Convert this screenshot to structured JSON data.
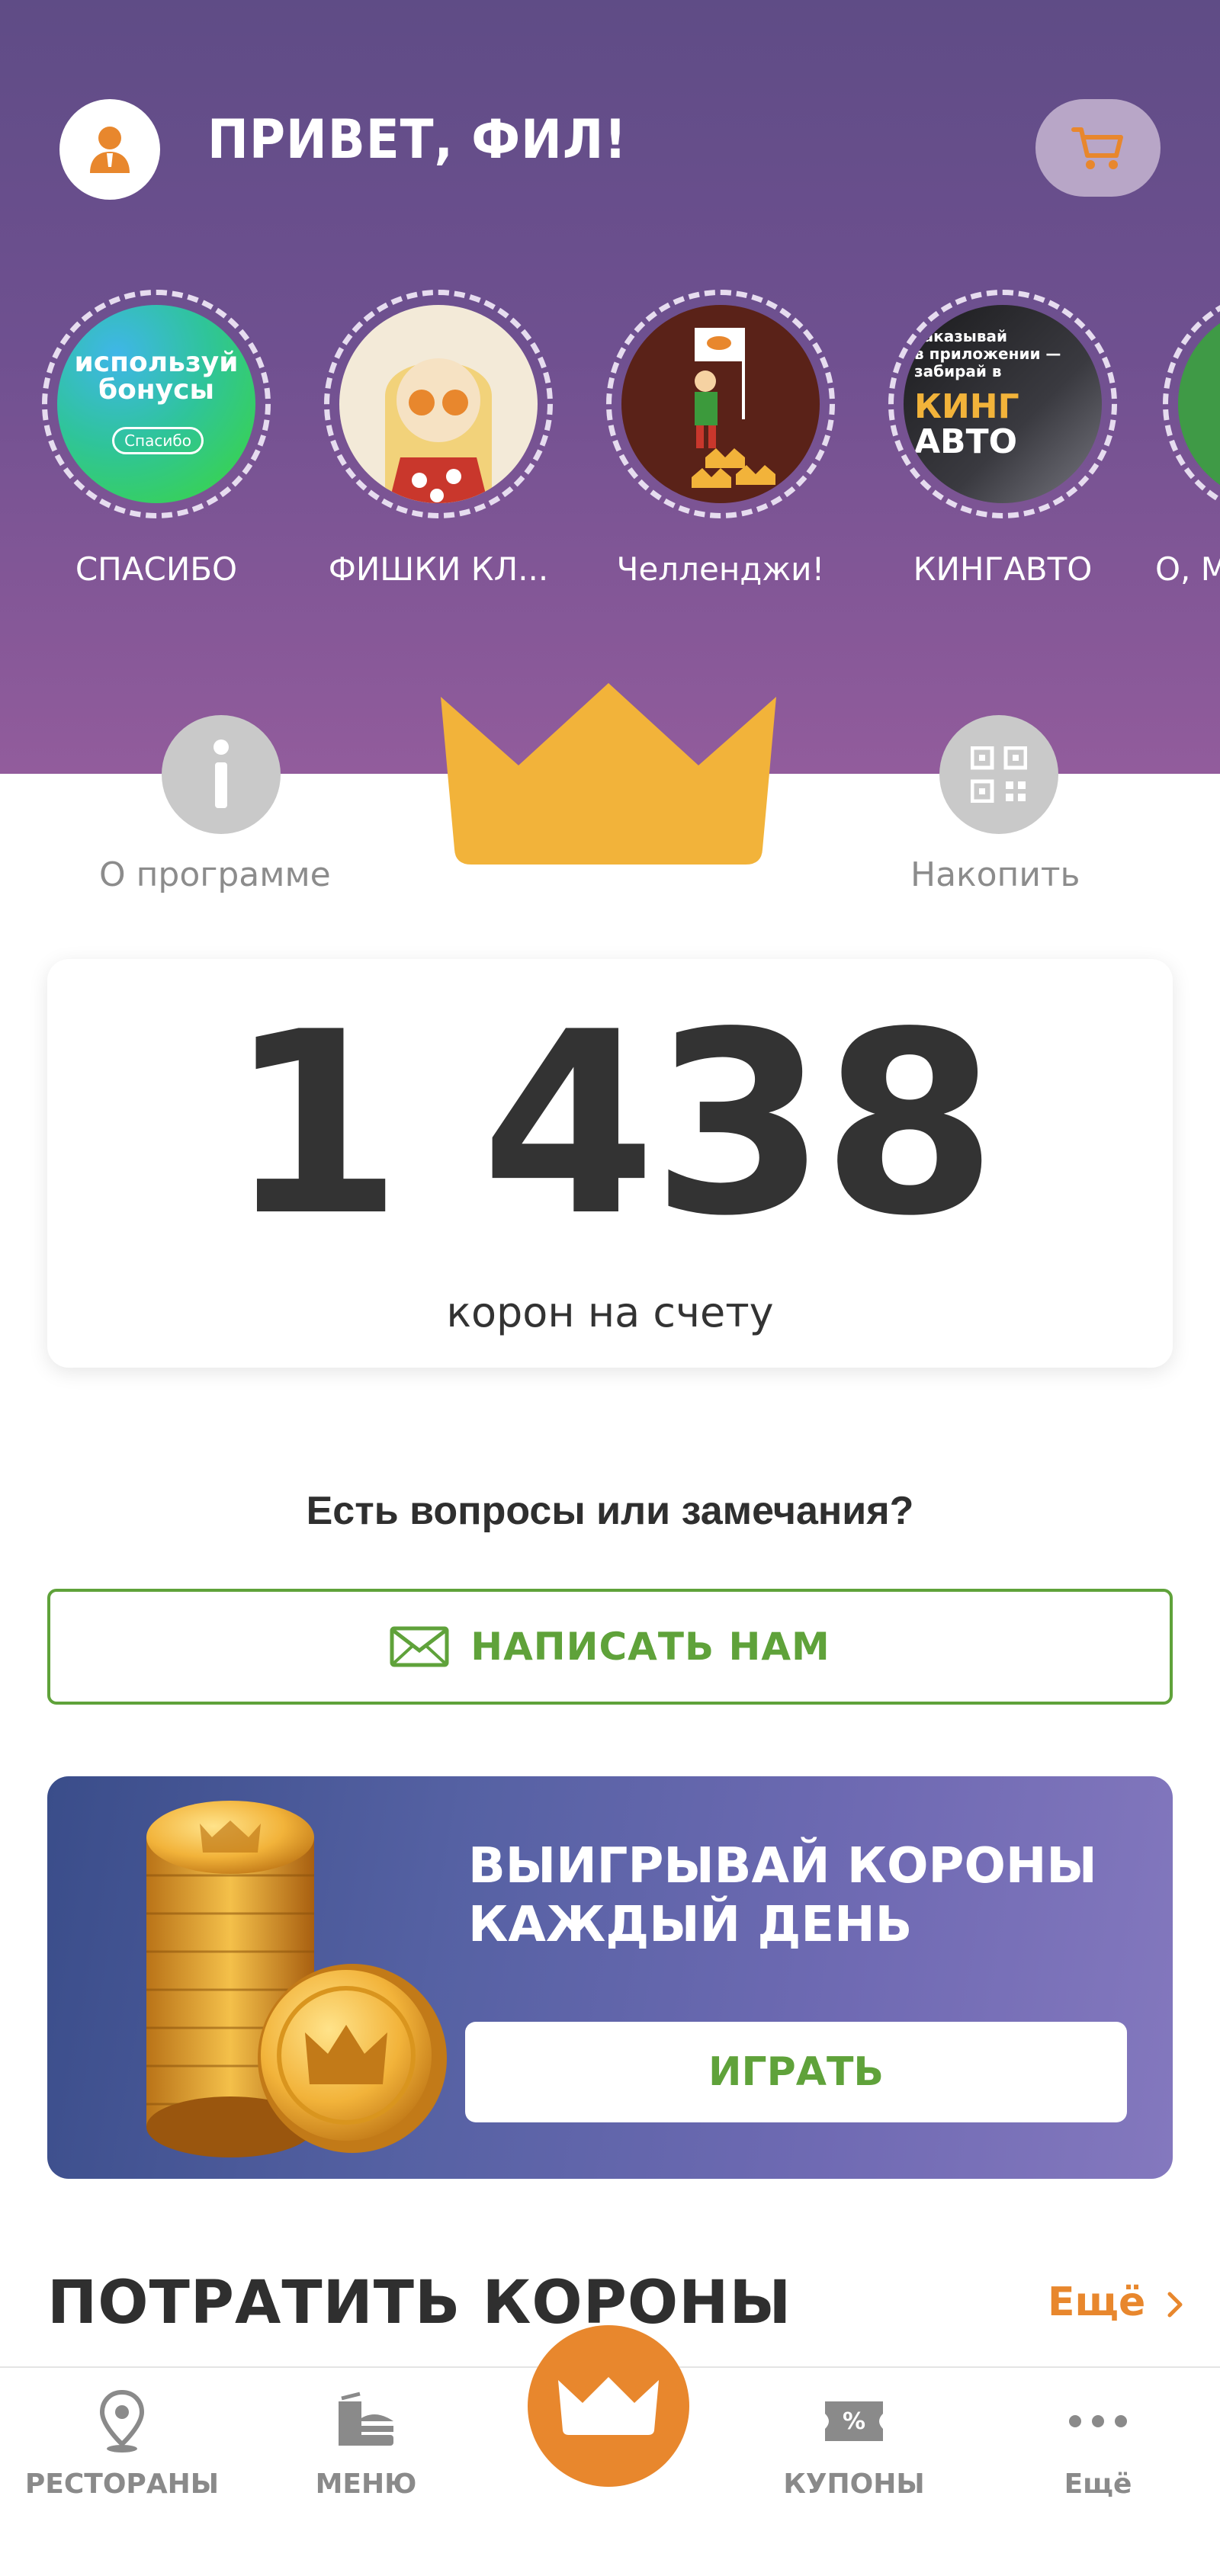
{
  "header": {
    "greeting": "ПРИВЕТ, ФИЛ!",
    "avatar_icon": "user-icon",
    "cart_icon": "cart-icon"
  },
  "stories": [
    {
      "label": "СПАСИБО",
      "title_lines": [
        "используй",
        "бонусы"
      ],
      "badge": "Спасибо"
    },
    {
      "label": "ФИШКИ КЛ..."
    },
    {
      "label": "Челленджи!"
    },
    {
      "label": "КИНГАВТО",
      "text_lines": [
        "заказывай",
        "в приложении —",
        "забирай в"
      ],
      "brand_top": "КИНГ",
      "brand_bottom": "АВТО"
    },
    {
      "label": "О, М"
    }
  ],
  "program": {
    "about_label": "О программе",
    "collect_label": "Накопить"
  },
  "balance": {
    "value": "1 438",
    "caption": "корон на счету"
  },
  "feedback": {
    "question": "Есть вопросы или замечания?",
    "button_label": "НАПИСАТЬ НАМ"
  },
  "promo": {
    "title_line1": "ВЫИГРЫВАЙ КОРОНЫ",
    "title_line2": "КАЖДЫЙ ДЕНЬ",
    "button_label": "ИГРАТЬ"
  },
  "spend": {
    "title": "ПОТРАТИТЬ КОРОНЫ",
    "more_label": "Ещё"
  },
  "tabbar": {
    "items": [
      {
        "label": "РЕСТОРАНЫ",
        "icon": "map-pin-icon"
      },
      {
        "label": "МЕНЮ",
        "icon": "burger-icon"
      },
      {
        "label": "",
        "icon": "crown-icon"
      },
      {
        "label": "КУПОНЫ",
        "icon": "coupon-icon"
      },
      {
        "label": "Ещё",
        "icon": "more-dots-icon"
      }
    ]
  },
  "colors": {
    "hero_top": "#5f4c86",
    "hero_bottom": "#925c9c",
    "crown_yellow": "#f2b33a",
    "accent_orange": "#e8872d",
    "accent_green": "#5fa23a"
  }
}
